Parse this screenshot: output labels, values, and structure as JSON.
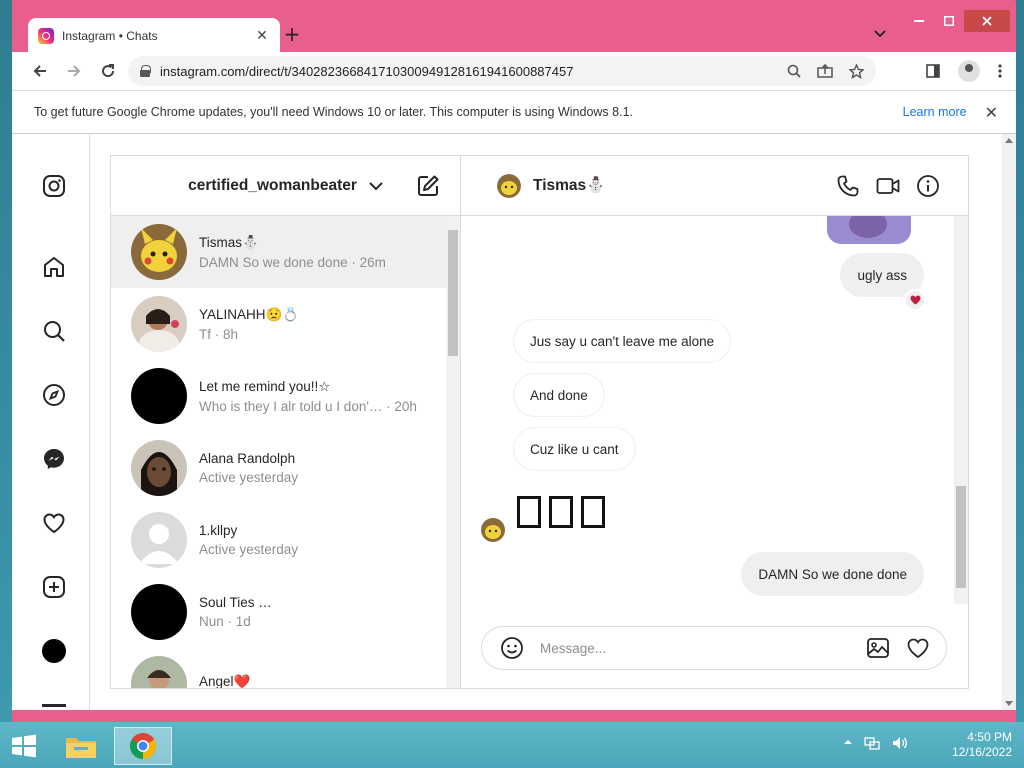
{
  "browser": {
    "tab_title": "Instagram • Chats",
    "tab_close": "✕",
    "new_tab": "+",
    "url": "instagram.com/direct/t/340282366841710300949128161941600887457",
    "infobar_message": "To get future Google Chrome updates, you'll need Windows 10 or later. This computer is using Windows 8.1.",
    "infobar_link": "Learn more",
    "infobar_close": "✕"
  },
  "inbox": {
    "username": "certified_womanbeater",
    "conversations": [
      {
        "name": "Tismas⛄",
        "sub": "DAMN So we done done · 26m",
        "avatar_color": "#e8c44a"
      },
      {
        "name": "YALINAHH😟💍",
        "sub": "Tf · 8h",
        "avatar_color": "#c9b8a8"
      },
      {
        "name": "Let me remind you!!☆",
        "sub": "Who is they I alr told u I don'… · 20h",
        "avatar_color": "#000000"
      },
      {
        "name": "Alana Randolph",
        "sub": "Active yesterday",
        "avatar_color": "#5a4334"
      },
      {
        "name": "1.kllpy",
        "sub": "Active yesterday",
        "avatar_color": "#dbdbdb"
      },
      {
        "name": "Soul Ties …",
        "sub": "Nun · 1d",
        "avatar_color": "#000000"
      },
      {
        "name": "Angel❤️",
        "sub": "",
        "avatar_color": "#b9c4b0"
      }
    ]
  },
  "chat": {
    "contact_name": "Tismas⛄",
    "messages": [
      {
        "text": "ugly ass",
        "direction": "sent"
      },
      {
        "text": "Jus say u can't leave me alone",
        "direction": "received"
      },
      {
        "text": "And done",
        "direction": "received"
      },
      {
        "text": "Cuz like u cant",
        "direction": "received"
      },
      {
        "text": "DAMN So we done done",
        "direction": "sent"
      }
    ],
    "composer_placeholder": "Message..."
  },
  "taskbar": {
    "time": "4:50 PM",
    "date": "12/16/2022"
  },
  "colors": {
    "window_frame": "#e95f8b",
    "link": "#1a73e8",
    "reaction_heart": "#c0203f"
  }
}
